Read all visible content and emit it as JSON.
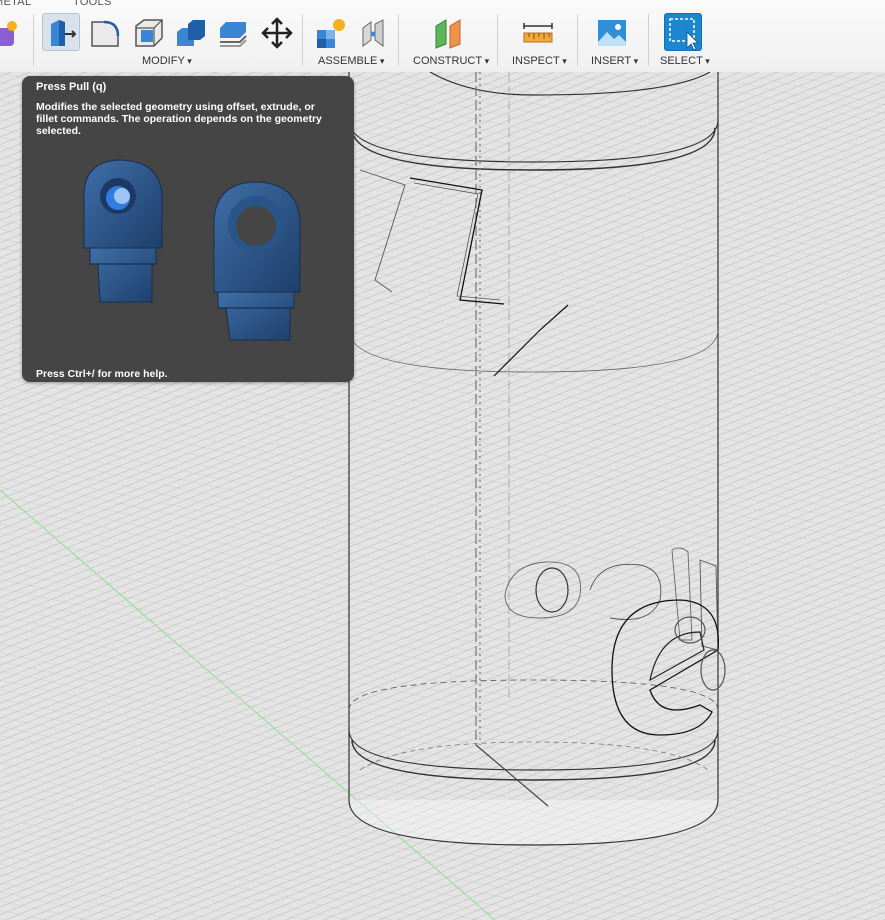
{
  "toolbar": {
    "tabs": [
      {
        "label": "METAL"
      },
      {
        "label": "TOOLS"
      }
    ],
    "groups": {
      "modify": "MODIFY",
      "assemble": "ASSEMBLE",
      "construct": "CONSTRUCT",
      "inspect": "INSPECT",
      "insert": "INSERT",
      "select": "SELECT"
    },
    "tools": [
      {
        "name": "create-form-icon"
      },
      {
        "name": "press-pull-icon",
        "active": true
      },
      {
        "name": "fillet-icon"
      },
      {
        "name": "shell-icon"
      },
      {
        "name": "combine-icon"
      },
      {
        "name": "offset-face-icon"
      },
      {
        "name": "move-icon"
      },
      {
        "name": "new-component-icon"
      },
      {
        "name": "joint-icon"
      },
      {
        "name": "offset-plane-icon"
      },
      {
        "name": "measure-icon"
      },
      {
        "name": "insert-image-icon"
      },
      {
        "name": "select-icon",
        "active": true
      }
    ]
  },
  "tooltip": {
    "title": "Press Pull (q)",
    "description": "Modifies the selected geometry using offset, extrude, or fillet commands. The operation depends on the geometry selected.",
    "help": "Press Ctrl+/ for more help."
  },
  "colors": {
    "accent": "#1c86d1",
    "model_blue": "#2f5a8c",
    "tooltip_bg": "#454545"
  }
}
